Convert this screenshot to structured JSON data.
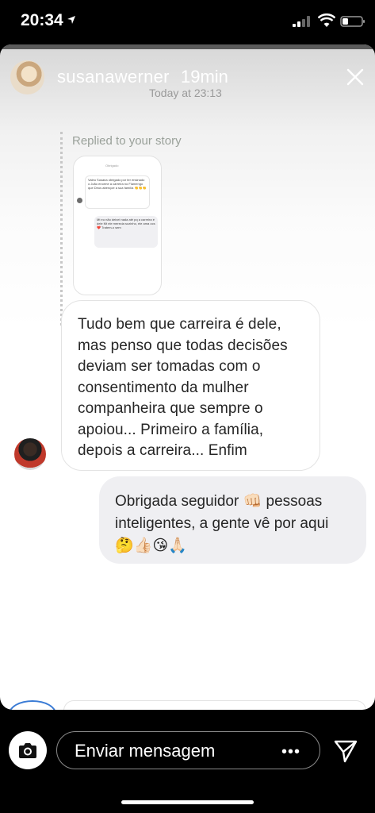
{
  "status_bar": {
    "time": "20:34"
  },
  "story_header": {
    "username": "susanawerner",
    "time_ago": "19min",
    "date": "Today at 23:13"
  },
  "conversation": {
    "replied_label": "Replied to your story",
    "story_thumbnail": {
      "top": "Obrigado",
      "bubble1": "Valeu Susana obrigado por ter ensinado o João enorme a carreira no Flamengo que Deus abençoe a sua família 👏👏👏",
      "bubble2": "Mt eu não deixei nada até pq a carreira é dele Mt ele merecia sozinho, ele ama ocs ❤️ Tratem-o sem"
    },
    "incoming_message": "Tudo bem que carreira é dele, mas penso que todas decisões deviam ser tomadas com o consentimento da mulher companheira que sempre o apoiou... Primeiro a família, depois a carreira... Enfim",
    "outgoing_message": "Obrigada seguidor 👊🏻 pessoas inteligentes, a gente vê por aqui 🤔👍🏻😘🙏🏻"
  },
  "composer": {
    "placeholder": "Enviar mensagem",
    "more_label": "•••"
  },
  "colors": {
    "background": "#000000",
    "card": "#ffffff",
    "outgoing_bubble": "#efeff2",
    "accent": "#3a7bd5"
  },
  "icons": [
    "location-arrow-icon",
    "signal-icon",
    "wifi-icon",
    "battery-icon",
    "close-icon",
    "camera-icon",
    "more-icon",
    "send-icon"
  ]
}
